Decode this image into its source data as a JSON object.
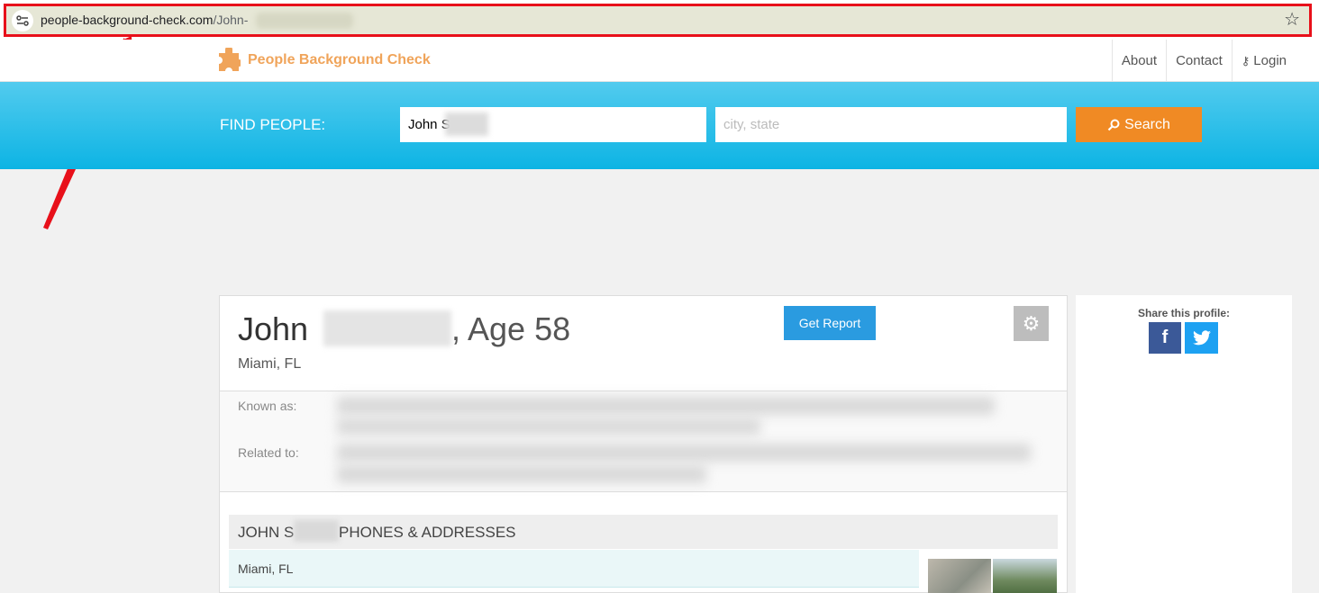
{
  "browser": {
    "url_domain": "people-background-check.com",
    "url_path": "/John-"
  },
  "site": {
    "logo_text": "People Background Check",
    "nav": [
      {
        "label": "About"
      },
      {
        "label": "Contact"
      },
      {
        "label": "Login"
      }
    ]
  },
  "search": {
    "label": "FIND PEOPLE:",
    "name_value": "John S",
    "city_placeholder": "city, state",
    "button_label": "Search"
  },
  "profile": {
    "first_name": "John",
    "age_text": ", Age 58",
    "location": "Miami, FL",
    "get_report_label": "Get Report",
    "known_as_label": "Known as:",
    "related_to_label": "Related to:",
    "section_title_left": "JOHN S",
    "section_title_right": "PHONES & ADDRESSES",
    "addresses": [
      "Miami, FL"
    ]
  },
  "share": {
    "label": "Share this profile:"
  },
  "colors": {
    "accent_orange": "#f08a24",
    "band_blue": "#0db4e4",
    "highlight_red": "#e8101a",
    "report_blue": "#2a9be0"
  }
}
